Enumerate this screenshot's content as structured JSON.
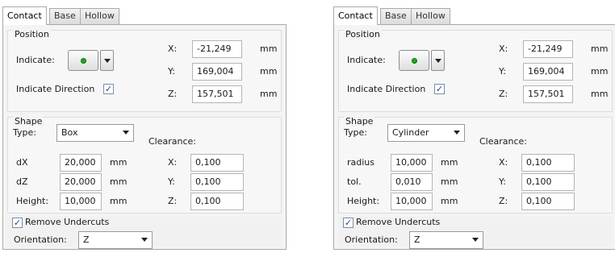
{
  "panels": [
    {
      "tabs": [
        "Contact",
        "Base",
        "Hollow"
      ],
      "position": {
        "title": "Position",
        "indicate_label": "Indicate:",
        "indicate_direction_label": "Indicate Direction",
        "indicate_direction_checked": true,
        "coords": [
          {
            "label": "X:",
            "value": "-21,249",
            "unit": "mm"
          },
          {
            "label": "Y:",
            "value": "169,004",
            "unit": "mm"
          },
          {
            "label": "Z:",
            "value": "157,501",
            "unit": "mm"
          }
        ]
      },
      "shape": {
        "title": "Shape",
        "type_label": "Type:",
        "type_value": "Box",
        "params": [
          {
            "label": "dX",
            "value": "20,000",
            "unit": "mm"
          },
          {
            "label": "dZ",
            "value": "20,000",
            "unit": "mm"
          },
          {
            "label": "Height:",
            "value": "10,000",
            "unit": "mm"
          }
        ],
        "clearance_label": "Clearance:",
        "clearance": [
          {
            "label": "X:",
            "value": "0,100"
          },
          {
            "label": "Y:",
            "value": "0,100"
          },
          {
            "label": "Z:",
            "value": "0,100"
          }
        ]
      },
      "undercuts": {
        "label": "Remove Undercuts",
        "checked": true,
        "orientation_label": "Orientation:",
        "orientation_value": "Z"
      }
    },
    {
      "tabs": [
        "Contact",
        "Base",
        "Hollow"
      ],
      "position": {
        "title": "Position",
        "indicate_label": "Indicate:",
        "indicate_direction_label": "Indicate Direction",
        "indicate_direction_checked": true,
        "coords": [
          {
            "label": "X:",
            "value": "-21,249",
            "unit": "mm"
          },
          {
            "label": "Y:",
            "value": "169,004",
            "unit": "mm"
          },
          {
            "label": "Z:",
            "value": "157,501",
            "unit": "mm"
          }
        ]
      },
      "shape": {
        "title": "Shape",
        "type_label": "Type:",
        "type_value": "Cylinder",
        "params": [
          {
            "label": "radius",
            "value": "10,000",
            "unit": "mm"
          },
          {
            "label": "tol.",
            "value": "0,010",
            "unit": "mm"
          },
          {
            "label": "Height:",
            "value": "10,000",
            "unit": "mm"
          }
        ],
        "clearance_label": "Clearance:",
        "clearance": [
          {
            "label": "X:",
            "value": "0,100"
          },
          {
            "label": "Y:",
            "value": "0,100"
          },
          {
            "label": "Z:",
            "value": "0,100"
          }
        ]
      },
      "undercuts": {
        "label": "Remove Undercuts",
        "checked": true,
        "orientation_label": "Orientation:",
        "orientation_value": "Z"
      }
    }
  ]
}
